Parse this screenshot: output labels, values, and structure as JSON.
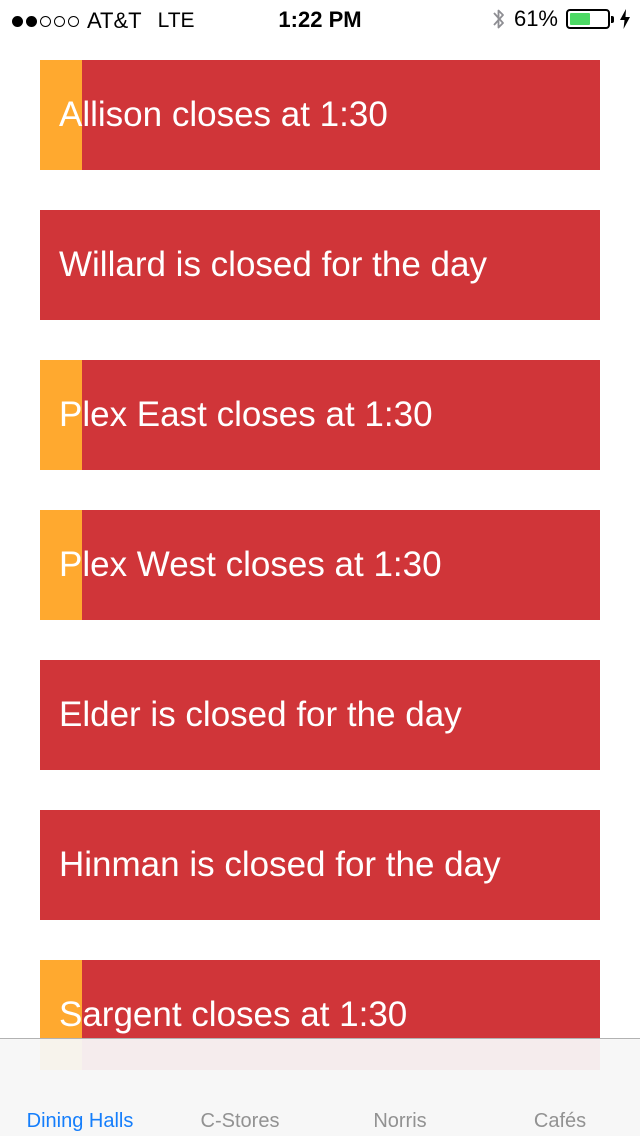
{
  "status_bar": {
    "signal_filled": 2,
    "signal_total": 5,
    "carrier": "AT&T",
    "network": "LTE",
    "time": "1:22 PM",
    "battery_percent_text": "61%",
    "battery_level": 0.61,
    "icons": [
      "signal-dots-icon",
      "bluetooth-icon",
      "battery-icon",
      "charging-bolt-icon"
    ]
  },
  "colors": {
    "card_background": "#d03539",
    "progress_fill": "#ffa92f",
    "tab_active": "#157efb",
    "tab_inactive": "#929292",
    "battery_fill": "#4cd964"
  },
  "halls": [
    {
      "name": "Allison",
      "status": "Allison closes at 1:30",
      "progress": 0.075
    },
    {
      "name": "Willard",
      "status": "Willard is closed for the day",
      "progress": 0
    },
    {
      "name": "Plex East",
      "status": "Plex East closes at 1:30",
      "progress": 0.075
    },
    {
      "name": "Plex West",
      "status": "Plex West closes at 1:30",
      "progress": 0.075
    },
    {
      "name": "Elder",
      "status": "Elder is closed for the day",
      "progress": 0
    },
    {
      "name": "Hinman",
      "status": "Hinman is closed for the day",
      "progress": 0
    },
    {
      "name": "Sargent",
      "status": "Sargent closes at 1:30",
      "progress": 0.075
    }
  ],
  "tabs": [
    {
      "label": "Dining Halls",
      "active": true
    },
    {
      "label": "C-Stores",
      "active": false
    },
    {
      "label": "Norris",
      "active": false
    },
    {
      "label": "Cafés",
      "active": false
    }
  ]
}
